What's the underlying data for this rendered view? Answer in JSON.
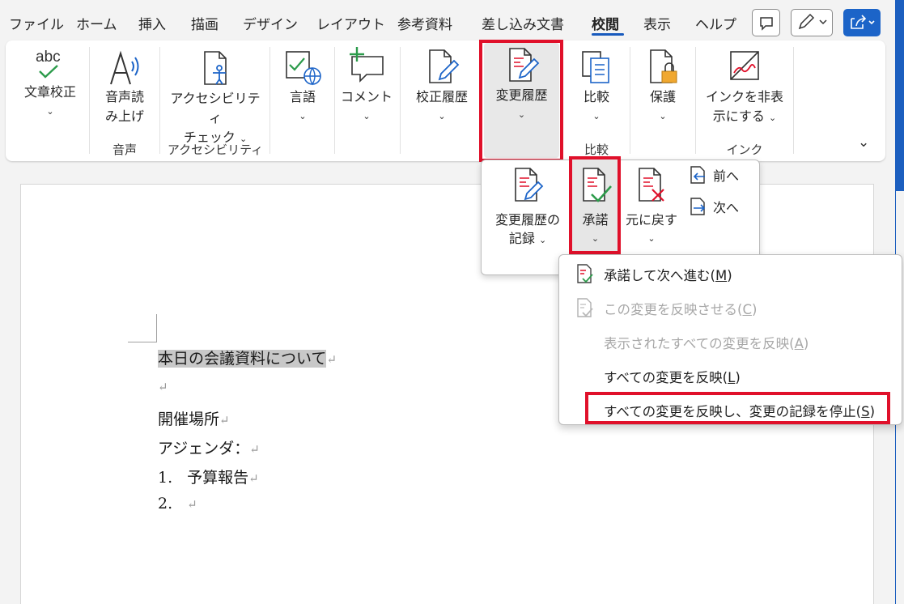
{
  "tabs": [
    {
      "label": "ファイル"
    },
    {
      "label": "ホーム"
    },
    {
      "label": "挿入"
    },
    {
      "label": "描画"
    },
    {
      "label": "デザイン"
    },
    {
      "label": "レイアウト"
    },
    {
      "label": "参考資料"
    },
    {
      "label": "差し込み文書"
    },
    {
      "label": "校閲"
    },
    {
      "label": "表示"
    },
    {
      "label": "ヘルプ"
    }
  ],
  "active_tab": "校閲",
  "ribbon": {
    "spelling": {
      "line1": "文章校正"
    },
    "read_aloud": {
      "line1": "音声読",
      "line2": "み上げ"
    },
    "accessibility": {
      "line1": "アクセシビリティ",
      "line2": "チェック"
    },
    "language": {
      "label": "言語"
    },
    "comment": {
      "label": "コメント"
    },
    "proofing_history": {
      "label": "校正履歴"
    },
    "track_changes": {
      "label": "変更履歴"
    },
    "compare": {
      "label": "比較"
    },
    "protect": {
      "label": "保護"
    },
    "ink": {
      "line1": "インクを非表",
      "line2": "示にする"
    },
    "groups": {
      "speech": "音声",
      "accessibility": "アクセシビリティ",
      "compare": "比較",
      "ink": "インク"
    }
  },
  "tracking_popup": {
    "track_changes": {
      "line1": "変更履歴の",
      "line2": "記録"
    },
    "accept": {
      "label": "承諾"
    },
    "reject": {
      "label": "元に戻す"
    },
    "previous": {
      "label": "前へ"
    },
    "next": {
      "label": "次へ"
    }
  },
  "accept_menu": [
    {
      "text": "承諾して次へ進む(",
      "key": "M",
      "end": ")",
      "disabled": false
    },
    {
      "text": "この変更を反映させる(",
      "key": "C",
      "end": ")",
      "disabled": true
    },
    {
      "text": "表示されたすべての変更を反映(",
      "key": "A",
      "end": ")",
      "disabled": true
    },
    {
      "text": "すべての変更を反映(",
      "key": "L",
      "end": ")",
      "disabled": false
    },
    {
      "text": "すべての変更を反映し、変更の記録を停止(",
      "key": "S",
      "end": ")",
      "disabled": false
    }
  ],
  "document": {
    "lines": [
      "本日の会議資料について",
      "",
      "開催場所",
      "アジェンダ：",
      "予算報告",
      ""
    ],
    "list_numbers": [
      "1.",
      "2."
    ],
    "para_mark": "↵"
  },
  "colors": {
    "accent": "#185abd",
    "highlight": "#e0102a",
    "selection": "#c8c8c8"
  }
}
